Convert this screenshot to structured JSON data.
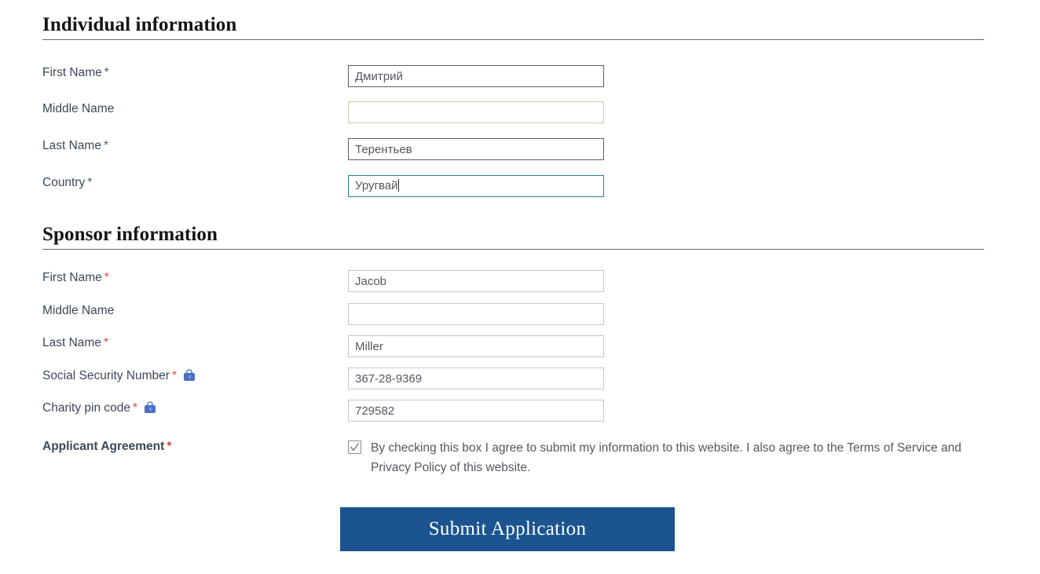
{
  "sections": [
    {
      "id": "individual",
      "title": "Individual information",
      "fields": [
        {
          "label": "First Name",
          "required": true,
          "asterisk_color": "gray",
          "value": "Дмитрий",
          "border": "dark",
          "focused": false,
          "lock": false
        },
        {
          "label": "Middle Name",
          "required": false,
          "asterisk_color": "gray",
          "value": "",
          "border": "khaki",
          "focused": false,
          "lock": false
        },
        {
          "label": "Last Name",
          "required": true,
          "asterisk_color": "gray",
          "value": "Терентьев",
          "border": "dark",
          "focused": false,
          "lock": false
        },
        {
          "label": "Country",
          "required": true,
          "asterisk_color": "gray",
          "value": "Уругвай",
          "border": "focus",
          "focused": true,
          "lock": false
        }
      ]
    },
    {
      "id": "sponsor",
      "title": "Sponsor information",
      "fields": [
        {
          "label": "First Name",
          "required": true,
          "asterisk_color": "red",
          "value": "Jacob",
          "border": "light",
          "focused": false,
          "lock": false
        },
        {
          "label": "Middle Name",
          "required": false,
          "asterisk_color": "red",
          "value": "",
          "border": "light",
          "focused": false,
          "lock": false
        },
        {
          "label": "Last Name",
          "required": true,
          "asterisk_color": "red",
          "value": "Miller",
          "border": "light",
          "focused": false,
          "lock": false
        },
        {
          "label": "Social Security Number",
          "required": true,
          "asterisk_color": "red",
          "value": "367-28-9369",
          "border": "light",
          "focused": false,
          "lock": true
        },
        {
          "label": "Charity pin code",
          "required": true,
          "asterisk_color": "red",
          "value": "729582",
          "border": "light",
          "focused": false,
          "lock": true
        }
      ]
    }
  ],
  "agreement": {
    "label": "Applicant Agreement",
    "required": true,
    "asterisk_color": "red",
    "checked": true,
    "text": "By checking this box I agree to submit my information to this website. I also agree to the Terms of Service and Privacy Policy of this website."
  },
  "submit": {
    "label": "Submit Application"
  },
  "symbols": {
    "asterisk": "*",
    "lock_icon": "lock-icon",
    "check_icon": "check-icon"
  },
  "colors": {
    "submit_background": "#1b5490",
    "submit_text": "#ffffff",
    "label_text": "#3c4858",
    "input_text": "#53585f",
    "required_red": "#cf4a4a",
    "required_gray": "#53585f",
    "focus_border": "#2f7d93",
    "khaki_border": "#cbc9a3",
    "dark_border": "#5c5f63",
    "light_border": "#c4c8cc",
    "lock_blue": "#4a6fc4"
  }
}
